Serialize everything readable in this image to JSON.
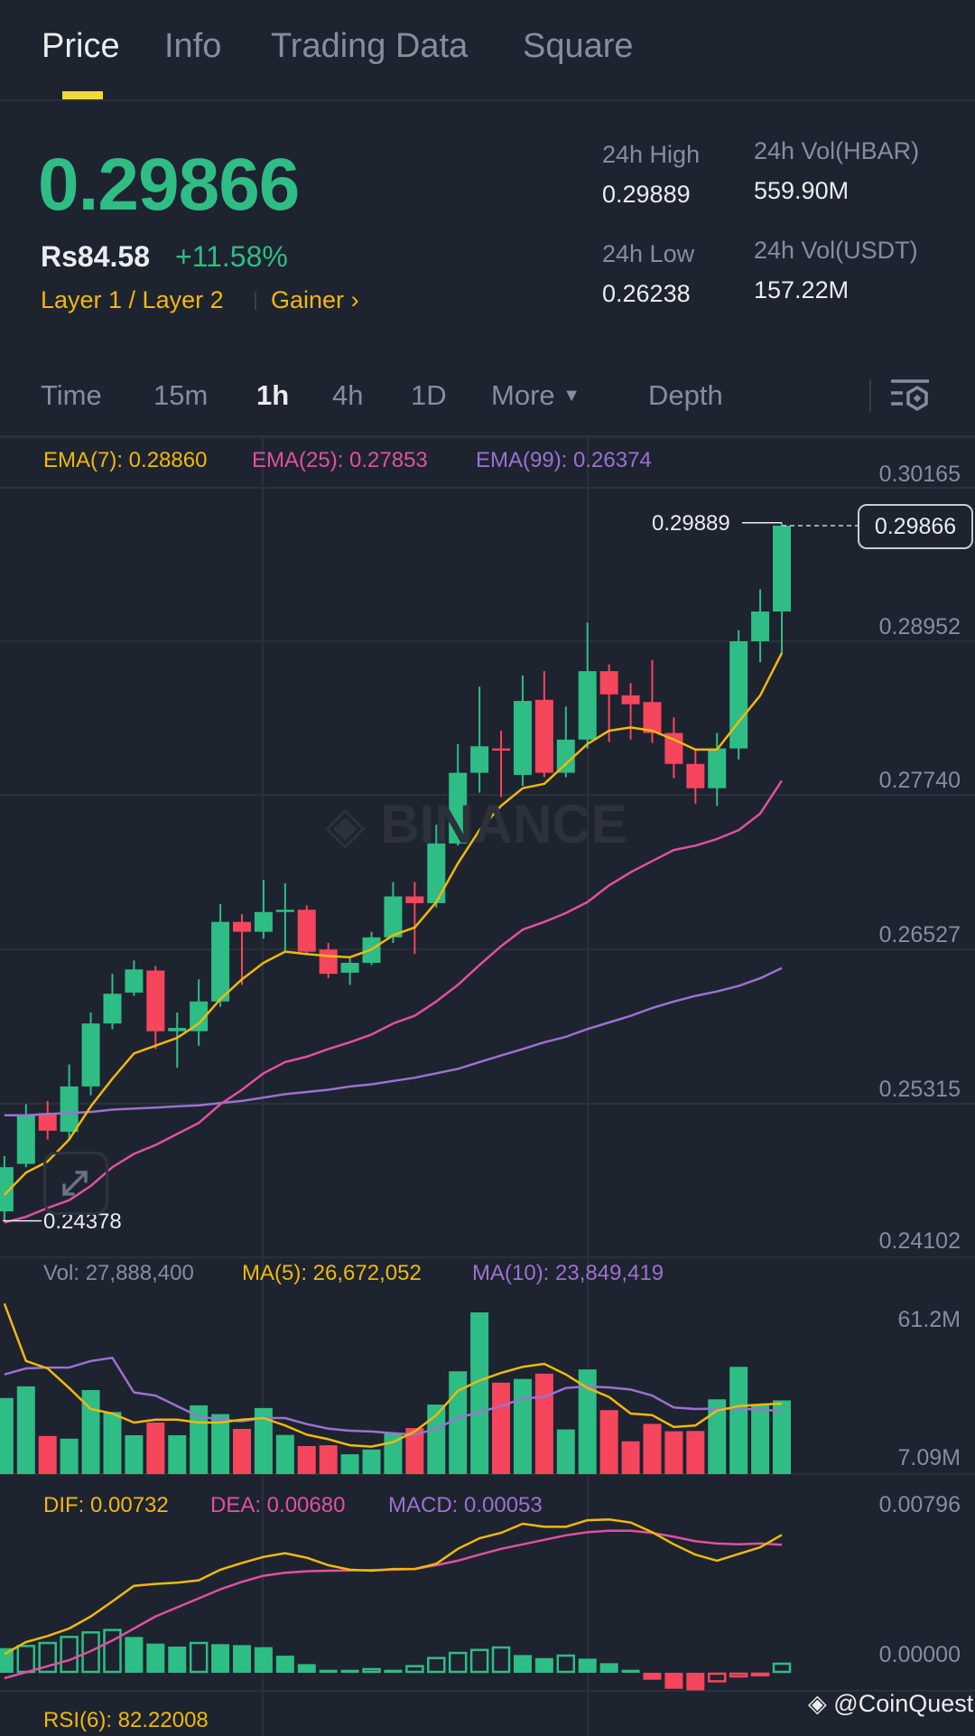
{
  "tabs": [
    {
      "label": "Price",
      "active": true
    },
    {
      "label": "Info"
    },
    {
      "label": "Trading Data"
    },
    {
      "label": "Square"
    }
  ],
  "ticker": {
    "last_price": "0.29866",
    "fiat_price": "Rs84.58",
    "change_pct": "+11.58%",
    "tag_category": "Layer 1 / Layer 2",
    "tag_gainer": "Gainer",
    "stats": {
      "high_label": "24h High",
      "high_value": "0.29889",
      "low_label": "24h Low",
      "low_value": "0.26238",
      "vol_base_label": "24h Vol(HBAR)",
      "vol_base_value": "559.90M",
      "vol_quote_label": "24h Vol(USDT)",
      "vol_quote_value": "157.22M"
    }
  },
  "timeframes": {
    "items": [
      "Time",
      "15m",
      "1h",
      "4h",
      "1D"
    ],
    "active": "1h",
    "more": "More",
    "depth": "Depth",
    "settings_icon": "indicator-settings-icon"
  },
  "colors": {
    "bg": "#1e2330",
    "up": "#2ebd85",
    "down": "#f6465d",
    "ema7": "#f0b90b",
    "ema25": "#e0519f",
    "ema99": "#9b72cf",
    "grid": "#2b303b"
  },
  "watermark": "BINANCE",
  "credit": "@CoinQuest",
  "chart_data": [
    {
      "type": "candlestick",
      "title": "HBAR/USDT 1h",
      "legend": {
        "ema7": "EMA(7): 0.28860",
        "ema25": "EMA(25): 0.27853",
        "ema99": "EMA(99): 0.26374"
      },
      "y_ticks": [
        "0.30165",
        "0.28952",
        "0.27740",
        "0.26527",
        "0.25315",
        "0.24102"
      ],
      "ylim": [
        0.24102,
        0.30165
      ],
      "current_price_label": "0.29866",
      "high_marker": "0.29889",
      "low_marker": "0.24378",
      "ohlc": [
        [
          0.24453,
          0.24889,
          0.24378,
          0.24802
        ],
        [
          0.24828,
          0.25299,
          0.24802,
          0.25212
        ],
        [
          0.25229,
          0.25325,
          0.2502,
          0.2509
        ],
        [
          0.25081,
          0.25613,
          0.2502,
          0.25439
        ],
        [
          0.25439,
          0.26023,
          0.25369,
          0.25936
        ],
        [
          0.25936,
          0.26328,
          0.25892,
          0.26171
        ],
        [
          0.2618,
          0.26433,
          0.26154,
          0.26363
        ],
        [
          0.26354,
          0.26389,
          0.25735,
          0.25875
        ],
        [
          0.25875,
          0.26023,
          0.25587,
          0.25901
        ],
        [
          0.25875,
          0.26285,
          0.25761,
          0.2611
        ],
        [
          0.2611,
          0.26878,
          0.26067,
          0.26738
        ],
        [
          0.26738,
          0.26799,
          0.26241,
          0.2666
        ],
        [
          0.2666,
          0.27069,
          0.26607,
          0.26816
        ],
        [
          0.26816,
          0.27043,
          0.26503,
          0.26834
        ],
        [
          0.26834,
          0.26869,
          0.26485,
          0.26503
        ],
        [
          0.2652,
          0.26572,
          0.26293,
          0.26328
        ],
        [
          0.26337,
          0.26459,
          0.26241,
          0.26415
        ],
        [
          0.26415,
          0.2666,
          0.26398,
          0.26616
        ],
        [
          0.26616,
          0.27052,
          0.26572,
          0.26939
        ],
        [
          0.26939,
          0.27052,
          0.26485,
          0.26886
        ],
        [
          0.26886,
          0.27505,
          0.26851,
          0.27357
        ],
        [
          0.27357,
          0.28142,
          0.2734,
          0.27915
        ],
        [
          0.27915,
          0.28595,
          0.27758,
          0.28124
        ],
        [
          0.28107,
          0.28247,
          0.27723,
          0.2809
        ],
        [
          0.27898,
          0.28683,
          0.27811,
          0.28482
        ],
        [
          0.28491,
          0.28717,
          0.2788,
          0.27915
        ],
        [
          0.27915,
          0.28438,
          0.2788,
          0.28177
        ],
        [
          0.28177,
          0.29101,
          0.28107,
          0.28717
        ],
        [
          0.28717,
          0.2877,
          0.28159,
          0.28534
        ],
        [
          0.28526,
          0.28622,
          0.28177,
          0.28456
        ],
        [
          0.28473,
          0.28805,
          0.28151,
          0.28229
        ],
        [
          0.28229,
          0.28351,
          0.27872,
          0.27985
        ],
        [
          0.27985,
          0.28107,
          0.27671,
          0.27793
        ],
        [
          0.27793,
          0.28229,
          0.27654,
          0.28107
        ],
        [
          0.28107,
          0.2904,
          0.2802,
          0.28953
        ],
        [
          0.28953,
          0.29363,
          0.28787,
          0.29188
        ],
        [
          0.29188,
          0.29889,
          0.28857,
          0.29866
        ]
      ],
      "ema7": [
        0.24584,
        0.24759,
        0.24846,
        0.2502,
        0.25282,
        0.255,
        0.257,
        0.25761,
        0.25822,
        0.25936,
        0.26128,
        0.26285,
        0.26415,
        0.26503,
        0.26485,
        0.26468,
        0.26459,
        0.2652,
        0.26633,
        0.26694,
        0.26895,
        0.272,
        0.27462,
        0.27654,
        0.27793,
        0.27828,
        0.27985,
        0.28142,
        0.28247,
        0.28273,
        0.28247,
        0.28177,
        0.28098,
        0.28098,
        0.28316,
        0.28526,
        0.2886
      ],
      "ema25": [
        0.24366,
        0.2441,
        0.2448,
        0.24541,
        0.24654,
        0.24802,
        0.24907,
        0.24977,
        0.25064,
        0.25151,
        0.25299,
        0.25413,
        0.25543,
        0.25631,
        0.25674,
        0.25735,
        0.25788,
        0.25849,
        0.25936,
        0.25997,
        0.2611,
        0.26241,
        0.26398,
        0.26546,
        0.26677,
        0.26738,
        0.26808,
        0.26895,
        0.27026,
        0.2713,
        0.27218,
        0.27305,
        0.2734,
        0.27392,
        0.27462,
        0.27593,
        0.27853
      ],
      "ema99": [
        0.25212,
        0.25212,
        0.25221,
        0.25229,
        0.25238,
        0.25256,
        0.25264,
        0.25273,
        0.25282,
        0.2529,
        0.25308,
        0.25325,
        0.25351,
        0.25378,
        0.25395,
        0.25413,
        0.25439,
        0.25456,
        0.25482,
        0.25508,
        0.25543,
        0.25578,
        0.25631,
        0.25683,
        0.25735,
        0.25788,
        0.25831,
        0.25892,
        0.25944,
        0.25996,
        0.26058,
        0.2611,
        0.26154,
        0.26189,
        0.26232,
        0.26293,
        0.26374
      ]
    },
    {
      "type": "bar",
      "title": "Volume",
      "legend": {
        "vol": "Vol: 27,888,400",
        "ma5": "MA(5): 26,672,052",
        "ma10": "MA(10): 23,849,419"
      },
      "y_ticks": [
        "61.2M",
        "7.09M"
      ],
      "ylim_millions": [
        0,
        61.2
      ],
      "values_millions": [
        28.8,
        33.2,
        14.4,
        13.4,
        31.8,
        23.5,
        14.7,
        19.5,
        14.7,
        26.0,
        22.7,
        17.1,
        25.0,
        14.8,
        10.6,
        10.9,
        7.5,
        9.3,
        15.5,
        17.4,
        26.3,
        38.9,
        61.2,
        34.6,
        36.0,
        38.0,
        16.9,
        39.6,
        24.2,
        12.4,
        19.0,
        16.2,
        16.3,
        28.3,
        40.6,
        26.2,
        27.89
      ],
      "ma5_millions": [
        64.5,
        42.8,
        40.0,
        32.6,
        24.6,
        22.9,
        19.5,
        20.6,
        20.6,
        19.5,
        19.5,
        20.6,
        21.2,
        18.4,
        14.9,
        13.2,
        10.9,
        10.4,
        12.1,
        16.1,
        22.3,
        31.5,
        35.4,
        38.3,
        40.6,
        41.7,
        37.7,
        32.6,
        29.2,
        22.9,
        22.3,
        17.8,
        18.4,
        24.0,
        25.7,
        26.3,
        26.67
      ],
      "ma10_millions": [
        37.7,
        40.0,
        40.3,
        40.3,
        42.8,
        44.0,
        30.9,
        29.7,
        25.7,
        21.8,
        20.6,
        20.0,
        21.2,
        21.2,
        18.9,
        17.2,
        16.4,
        16.1,
        15.5,
        14.9,
        17.2,
        21.2,
        23.5,
        25.7,
        28.6,
        29.2,
        32.6,
        33.2,
        32.8,
        32.0,
        29.7,
        25.2,
        24.6,
        24.8,
        24.8,
        24.4,
        23.85
      ]
    },
    {
      "type": "line",
      "title": "MACD",
      "legend": {
        "dif": "DIF: 0.00732",
        "dea": "DEA: 0.00680",
        "macd": "MACD: 0.00053"
      },
      "y_ticks": [
        "0.00796",
        "0.00000"
      ],
      "dif": [
        0.00099,
        0.00163,
        0.00195,
        0.00235,
        0.00299,
        0.00379,
        0.00462,
        0.00472,
        0.00478,
        0.00491,
        0.00547,
        0.00583,
        0.00615,
        0.00635,
        0.00611,
        0.00571,
        0.00547,
        0.00542,
        0.00551,
        0.00551,
        0.00579,
        0.00658,
        0.00714,
        0.00743,
        0.00791,
        0.00775,
        0.00775,
        0.0081,
        0.00814,
        0.00798,
        0.00746,
        0.00682,
        0.00627,
        0.00595,
        0.00631,
        0.00666,
        0.00732
      ],
      "dea": [
        -0.00029,
        3e-05,
        0.00035,
        0.00067,
        0.00115,
        0.00171,
        0.00235,
        0.00299,
        0.00347,
        0.00395,
        0.00443,
        0.00483,
        0.00515,
        0.00531,
        0.00539,
        0.00542,
        0.00543,
        0.00545,
        0.00547,
        0.00551,
        0.00571,
        0.00595,
        0.00627,
        0.00658,
        0.00682,
        0.00706,
        0.0073,
        0.00746,
        0.00754,
        0.00754,
        0.00743,
        0.00722,
        0.00698,
        0.00686,
        0.00682,
        0.00686,
        0.0068
      ],
      "histogram": [
        0.00131,
        0.00147,
        0.00163,
        0.00195,
        0.00219,
        0.00232,
        0.0019,
        0.00155,
        0.00139,
        0.00163,
        0.00152,
        0.00147,
        0.00136,
        0.00091,
        0.00046,
        0.00016,
        0.00016,
        0.00024,
        0.00016,
        0.0004,
        0.00083,
        0.0011,
        0.00126,
        0.00139,
        0.00094,
        0.00078,
        0.00096,
        0.00075,
        0.00051,
        0.00016,
        -0.00037,
        -0.00085,
        -0.00093,
        -0.0005,
        -0.00024,
        -0.00018,
        0.00053
      ]
    },
    {
      "type": "line",
      "title": "RSI",
      "legend": {
        "rsi": "RSI(6): 82.22008"
      }
    }
  ]
}
